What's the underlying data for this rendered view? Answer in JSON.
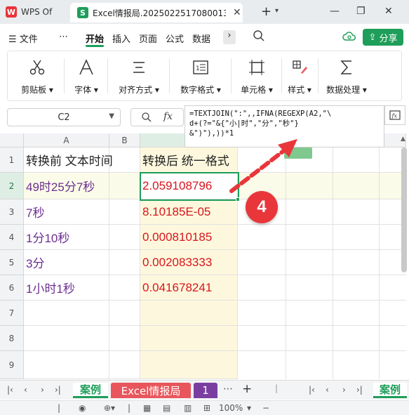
{
  "titlebar": {
    "wps_tab_label": "WPS Of",
    "doc_tab_label": "Excel情报局.2025022517080013",
    "close_glyph": "✕",
    "new_tab_glyph": "+",
    "new_tab_caret": "▾",
    "window": {
      "minimize": "—",
      "restore": "❐",
      "close": "✕"
    }
  },
  "menu": {
    "file": "文件",
    "more": "⋯",
    "items": [
      "开始",
      "插入",
      "页面",
      "公式",
      "数据"
    ],
    "active": "开始",
    "overflow": "›",
    "search_icon": "search-icon",
    "share_label": "分享"
  },
  "ribbon": {
    "groups": [
      {
        "label": "剪贴板",
        "icon": "scissors-icon"
      },
      {
        "label": "字体",
        "icon": "font-icon"
      },
      {
        "label": "对齐方式",
        "icon": "align-icon"
      },
      {
        "label": "数字格式",
        "icon": "number-format-icon"
      },
      {
        "label": "单元格",
        "icon": "cell-icon"
      },
      {
        "label": "样式",
        "icon": "style-brush-icon"
      },
      {
        "label": "数据处理",
        "icon": "sigma-icon"
      }
    ],
    "caret": "▾"
  },
  "formula_bar": {
    "name_box": "C2",
    "fx": "fx",
    "formula_lines": [
      "=TEXTJOIN(\":\",,IFNA(REGEXP(A2,\"\\",
      "d+(?=\"&{\"小|时\",\"分\",\"秒\"}",
      "&\")\"),))*1"
    ]
  },
  "grid": {
    "columns": [
      "A",
      "B",
      "C"
    ],
    "selected_column": "C",
    "rows": [
      "1",
      "2",
      "3",
      "4",
      "5",
      "6",
      "7",
      "8",
      "9"
    ],
    "selected_row": "2",
    "header_a": "转换前 文本时间",
    "header_c": "转换后 统一格式",
    "data": [
      {
        "a": "49时25分7秒",
        "c": "2.059108796"
      },
      {
        "a": "7秒",
        "c": "8.10185E-05"
      },
      {
        "a": "1分10秒",
        "c": "0.000810185"
      },
      {
        "a": "3分",
        "c": "0.002083333"
      },
      {
        "a": "1小时1秒",
        "c": "0.041678241"
      }
    ],
    "colors": {
      "text_a": "#6b2f8f",
      "text_c": "#d8151d",
      "header": "#222222"
    }
  },
  "annotation": {
    "badge": "4",
    "color": "#e8363b"
  },
  "sheets": {
    "nav": [
      "|‹",
      "‹",
      "›",
      "›|"
    ],
    "tabs": [
      "案例",
      "Excel情报局",
      "1"
    ],
    "more": "⋯",
    "add": "+",
    "active": "案例",
    "right_tab": "案例"
  },
  "status": {
    "zoom": "100%",
    "zoom_minus": "−"
  }
}
